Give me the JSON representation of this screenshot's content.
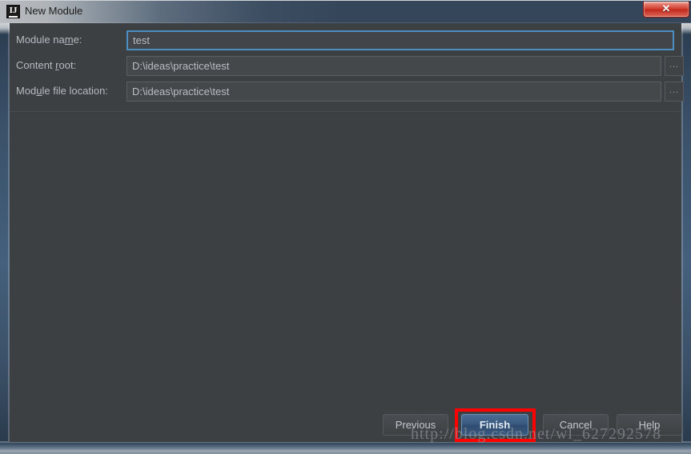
{
  "window": {
    "title": "New Module",
    "icon": "intellij-idea-icon",
    "close_label": "✕",
    "close_icon": "close-icon"
  },
  "form": {
    "rows": [
      {
        "label_before": "Module na",
        "label_mnemonic": "m",
        "label_after": "e:",
        "label_full": "Module name:",
        "value": "test",
        "has_browse": false,
        "focused": true
      },
      {
        "label_before": "Content ",
        "label_mnemonic": "r",
        "label_after": "oot:",
        "label_full": "Content root:",
        "value": "D:\\ideas\\practice\\test",
        "has_browse": true,
        "focused": false
      },
      {
        "label_before": "Mod",
        "label_mnemonic": "u",
        "label_after": "le file location:",
        "label_full": "Module file location:",
        "value": "D:\\ideas\\practice\\test",
        "has_browse": true,
        "focused": false
      }
    ],
    "browse_label": "..."
  },
  "footer": {
    "previous_label": "Previous",
    "finish_label": "Finish",
    "cancel_label": "Cancel",
    "help_label": "Help"
  },
  "annotation": {
    "highlight_color": "#ff0000",
    "target": "finish-button"
  },
  "watermark": {
    "text": "http://blog.csdn.net/wl_627292578"
  },
  "colors": {
    "dialog_background": "#3c4043",
    "titlebar_background": "#36465a",
    "input_background": "#45484b",
    "focus_border": "#4a8ec2",
    "finish_accent": "#3a5a80",
    "close_button": "#cf3b2c"
  }
}
